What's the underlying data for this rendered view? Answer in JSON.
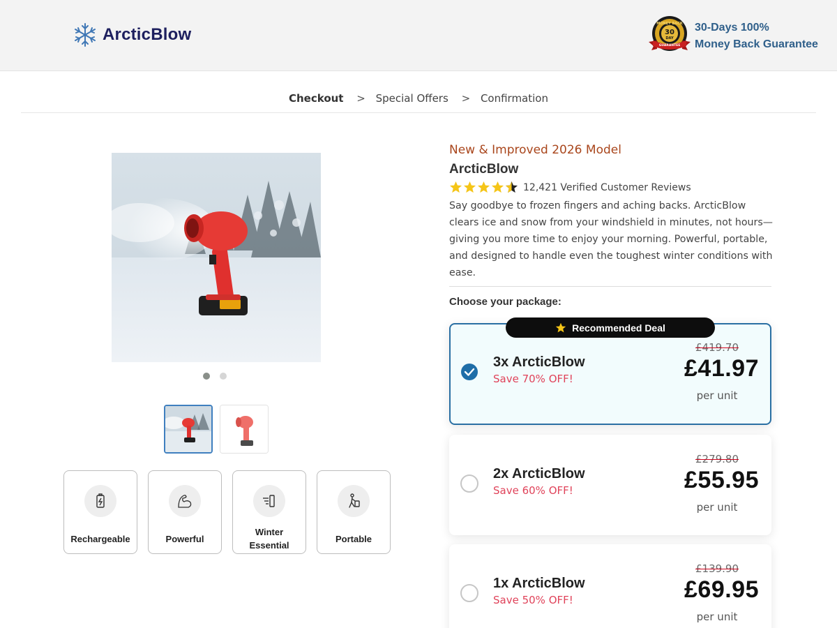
{
  "header": {
    "brand": "ArcticBlow",
    "logo_icon": "snowflake-icon",
    "seal_text": [
      "MONEY BACK",
      "30",
      "DAY",
      "GUARANTEE"
    ],
    "guarantee_line1": "30-Days 100%",
    "guarantee_line2": "Money Back Guarantee"
  },
  "breadcrumb": {
    "steps": [
      "Checkout",
      "Special Offers",
      "Confirmation"
    ],
    "separator": ">"
  },
  "gallery": {
    "slides": 2,
    "active_slide": 1,
    "features": [
      {
        "label": "Rechargeable",
        "icon": "battery-icon"
      },
      {
        "label": "Powerful",
        "icon": "flexed-arm-icon"
      },
      {
        "label": "Winter Essential",
        "icon": "windshield-wiper-icon"
      },
      {
        "label": "Portable",
        "icon": "walking-person-icon"
      }
    ]
  },
  "product": {
    "kicker": "New & Improved 2026 Model",
    "name": "ArcticBlow",
    "rating": 4.5,
    "reviews": "12,421 Verified Customer Reviews",
    "description": "Say goodbye to frozen fingers and aching backs. ArcticBlow clears ice and snow from your windshield in minutes, not hours—giving you more time to enjoy your morning. Powerful, portable, and designed to handle even the toughest winter conditions with ease.",
    "choose_label": "Choose your package:"
  },
  "packages": [
    {
      "title": "3x ArcticBlow",
      "save": "Save 70% OFF!",
      "old_price": "£419.70",
      "price": "£41.97",
      "unit": "per unit",
      "selected": true,
      "badge": "Recommended Deal"
    },
    {
      "title": "2x ArcticBlow",
      "save": "Save 60% OFF!",
      "old_price": "£279.80",
      "price": "£55.95",
      "unit": "per unit",
      "selected": false
    },
    {
      "title": "1x ArcticBlow",
      "save": "Save 50% OFF!",
      "old_price": "£139.90",
      "price": "£69.95",
      "unit": "per unit",
      "selected": false
    }
  ],
  "colors": {
    "brand_navy": "#1d1f5e",
    "guarantee_blue": "#2f5f8a",
    "kicker_orange": "#a9461c",
    "save_red": "#e0435a",
    "selected_border": "#2a6fa3",
    "star_yellow": "#f5c518"
  }
}
